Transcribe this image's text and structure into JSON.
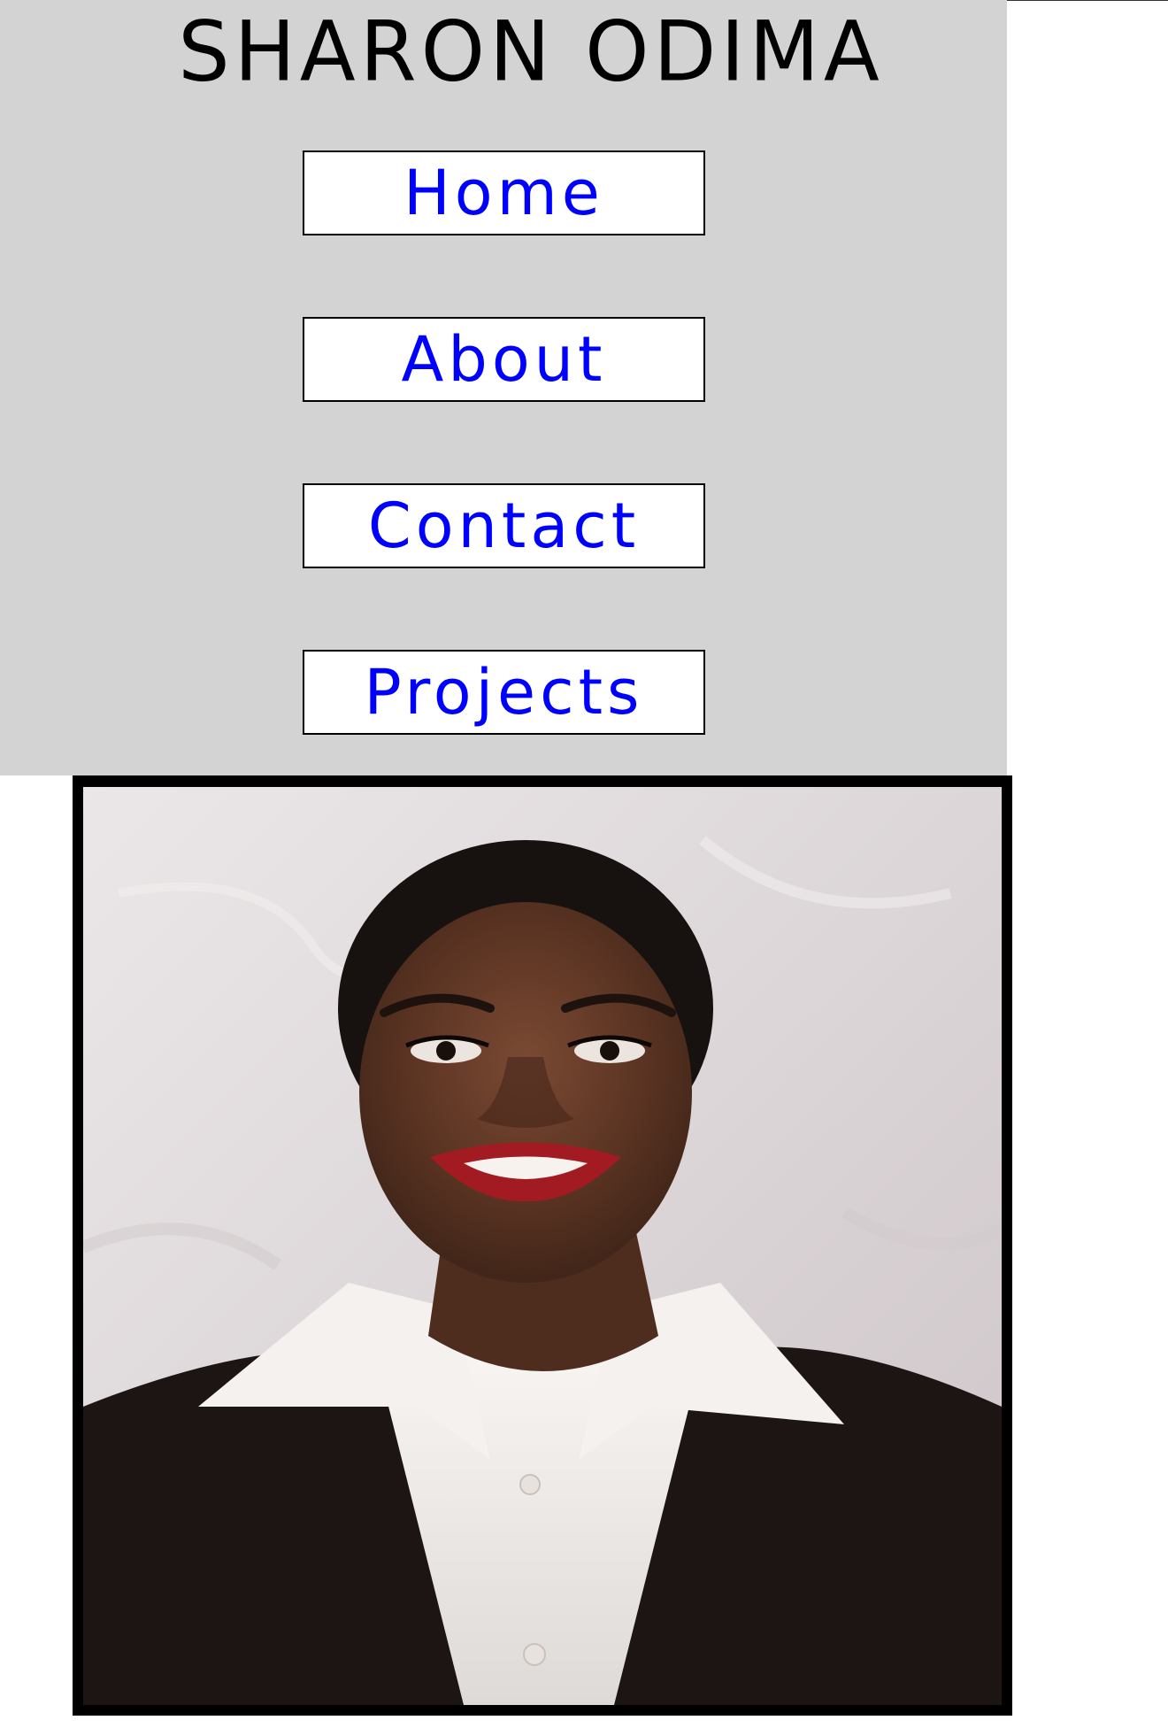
{
  "header": {
    "title": "SHARON ODIMA",
    "background_color": "#d3d3d3"
  },
  "nav": {
    "items": [
      {
        "label": "Home"
      },
      {
        "label": "About"
      },
      {
        "label": "Contact"
      },
      {
        "label": "Projects"
      }
    ],
    "link_color": "#0000ff"
  },
  "portrait": {
    "subject": "smiling woman with dark hair, red lipstick, white collared shirt and black blazer",
    "frame_color": "#000000"
  }
}
